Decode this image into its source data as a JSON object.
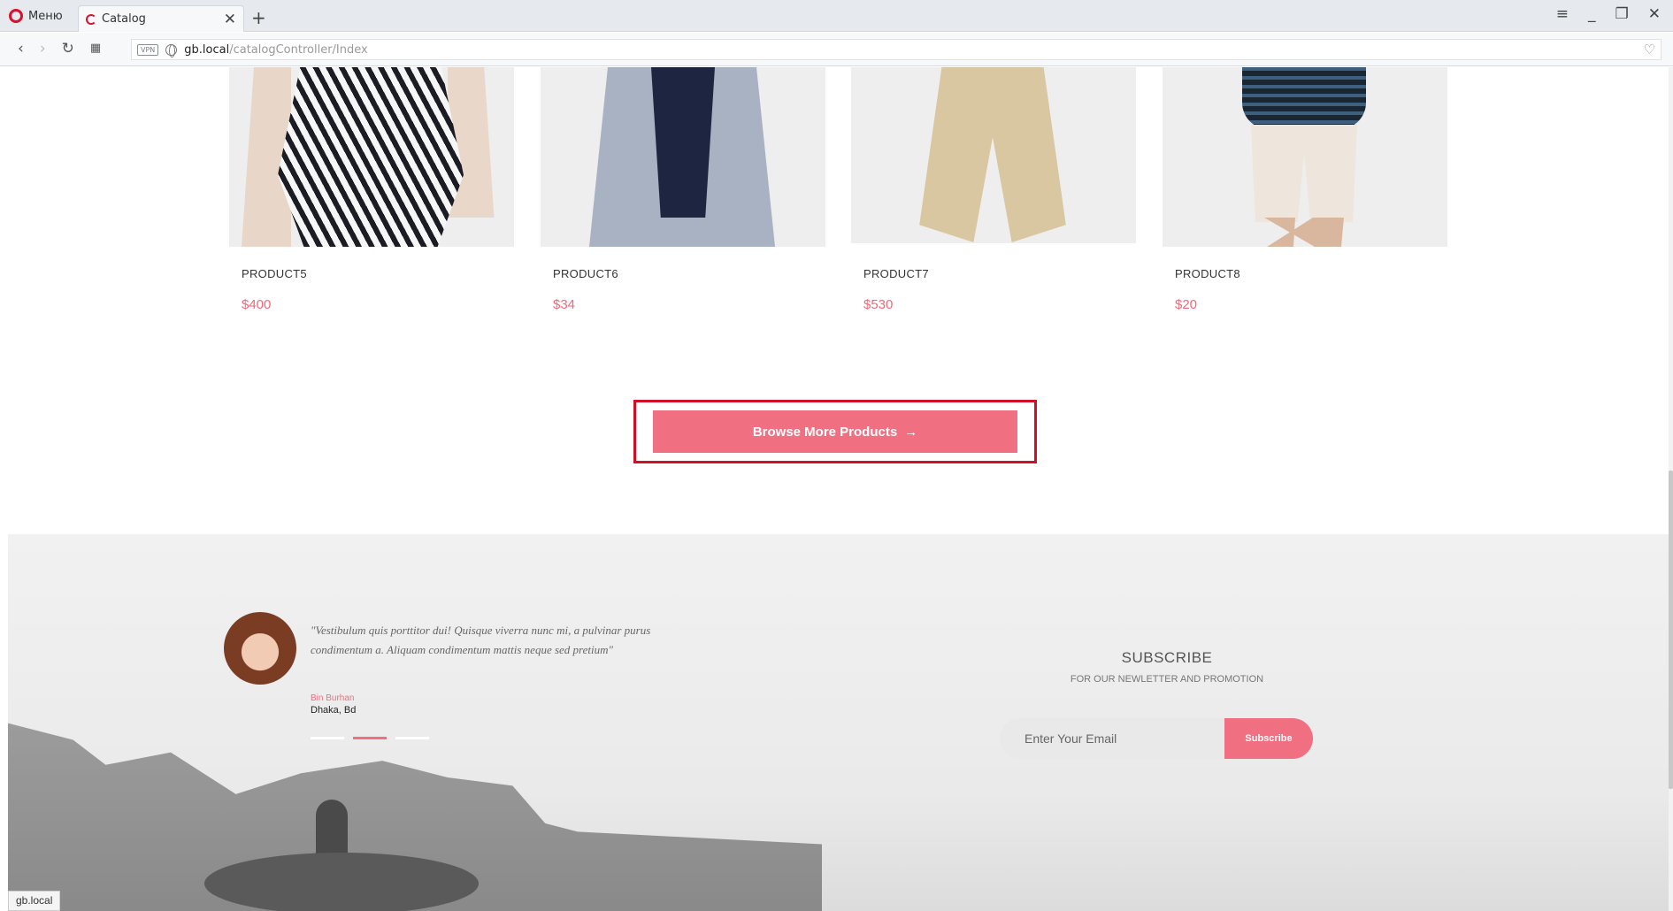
{
  "browser": {
    "menu_label": "Меню",
    "tab_title": "Catalog",
    "url_host": "gb.local",
    "url_path": "/catalogController/Index",
    "vpn_label": "VPN",
    "status_url": "gb.local"
  },
  "products": [
    {
      "name": "PRODUCT5",
      "price": "$400"
    },
    {
      "name": "PRODUCT6",
      "price": "$34"
    },
    {
      "name": "PRODUCT7",
      "price": "$530"
    },
    {
      "name": "PRODUCT8",
      "price": "$20"
    }
  ],
  "browse": {
    "label": "Browse More Products",
    "arrow": "→"
  },
  "testimonial": {
    "quote": "\"Vestibulum quis porttitor dui! Quisque viverra nunc mi, a pulvinar purus condimentum a. Aliquam condimentum mattis neque sed pretium\"",
    "author": "Bin Burhan",
    "location": "Dhaka, Bd",
    "slides": 3,
    "active_slide": 2
  },
  "subscribe": {
    "title": "SUBSCRIBE",
    "subtitle": "FOR OUR NEWLETTER AND PROMOTION",
    "placeholder": "Enter Your Email",
    "button": "Subscribe"
  },
  "colors": {
    "accent": "#f06f81",
    "highlight_border": "#d10f27"
  },
  "icons": [
    "opera-logo-icon",
    "close-icon",
    "plus-icon",
    "back-icon",
    "forward-icon",
    "reload-icon",
    "speed-dial-icon",
    "globe-icon",
    "heart-icon",
    "minimize-icon",
    "restore-icon"
  ]
}
